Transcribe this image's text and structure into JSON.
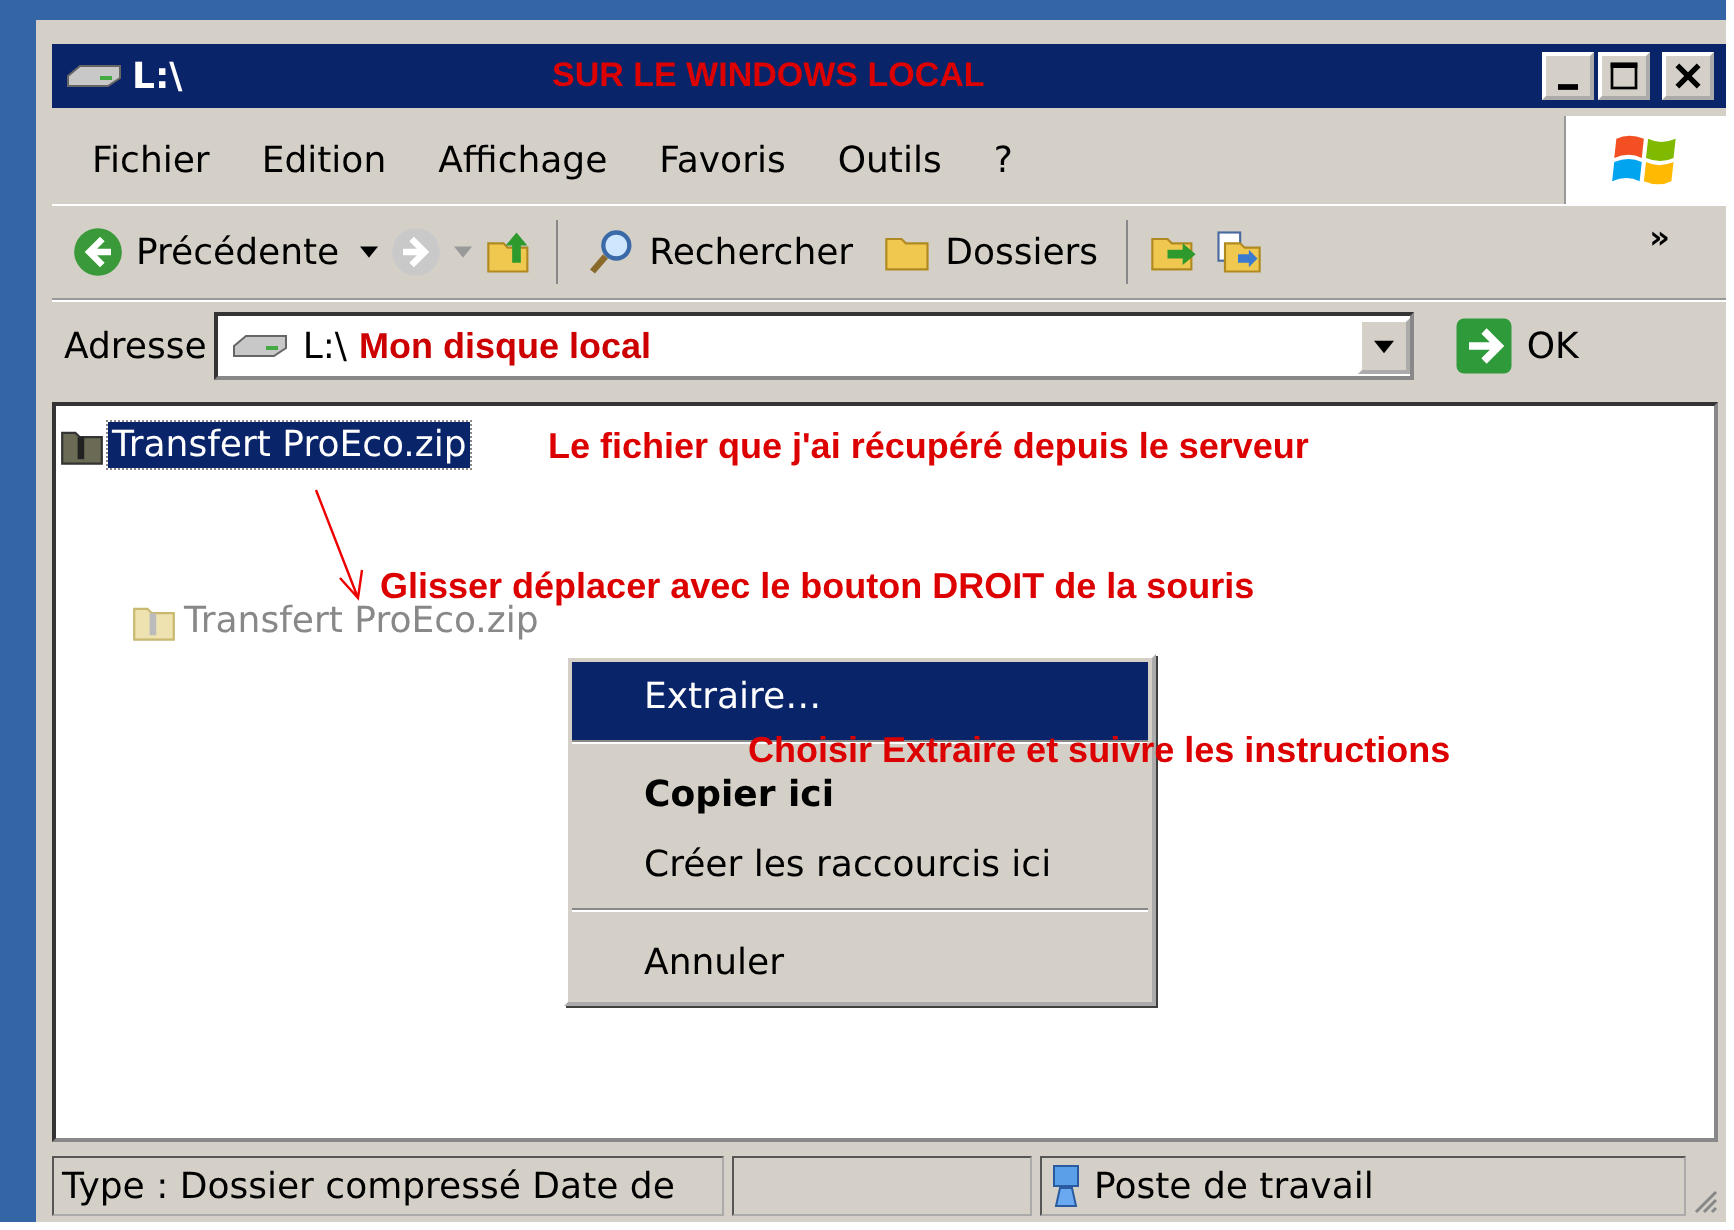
{
  "window": {
    "title": "L:\\",
    "banner": "SUR LE WINDOWS LOCAL"
  },
  "menu": [
    "Fichier",
    "Edition",
    "Affichage",
    "Favoris",
    "Outils",
    "?"
  ],
  "toolbar": {
    "back": "Précédente",
    "search": "Rechercher",
    "folders": "Dossiers",
    "overflow": "»"
  },
  "address": {
    "label": "Adresse",
    "value": "L:\\",
    "note": "Mon disque local",
    "go": "OK"
  },
  "files": [
    {
      "name": "Transfert ProEco.zip",
      "selected": true,
      "ghost": false
    },
    {
      "name": "Transfert ProEco.zip",
      "selected": false,
      "ghost": true
    }
  ],
  "annotations": [
    "Le fichier que j'ai récupéré depuis le serveur",
    "Glisser déplacer avec le bouton DROIT de la souris",
    "Choisir Extraire et suivre les instructions"
  ],
  "context_menu": [
    {
      "label": "Extraire…",
      "selected": true,
      "bold": false,
      "separator_after": true
    },
    {
      "label": "Copier ici",
      "selected": false,
      "bold": true,
      "separator_after": false
    },
    {
      "label": "Créer les raccourcis ici",
      "selected": false,
      "bold": false,
      "separator_after": true
    },
    {
      "label": "Annuler",
      "selected": false,
      "bold": false,
      "separator_after": false
    }
  ],
  "status_bar": {
    "details": "Type : Dossier compressé Date de",
    "location": "Poste de travail"
  }
}
